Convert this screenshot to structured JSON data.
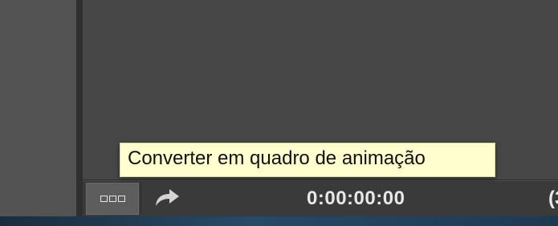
{
  "tooltip": {
    "text": "Converter em quadro de animação"
  },
  "timeline": {
    "timecode": "0:00:00:00",
    "fps_partial": "(3"
  },
  "icons": {
    "convert": "convert-frame-animation-icon",
    "share": "share-arrow-icon"
  },
  "colors": {
    "panel_bg": "#474747",
    "bar_bg": "#3a3a3a",
    "tooltip_bg": "#fefece",
    "timecode_text": "#e8e8e8"
  }
}
